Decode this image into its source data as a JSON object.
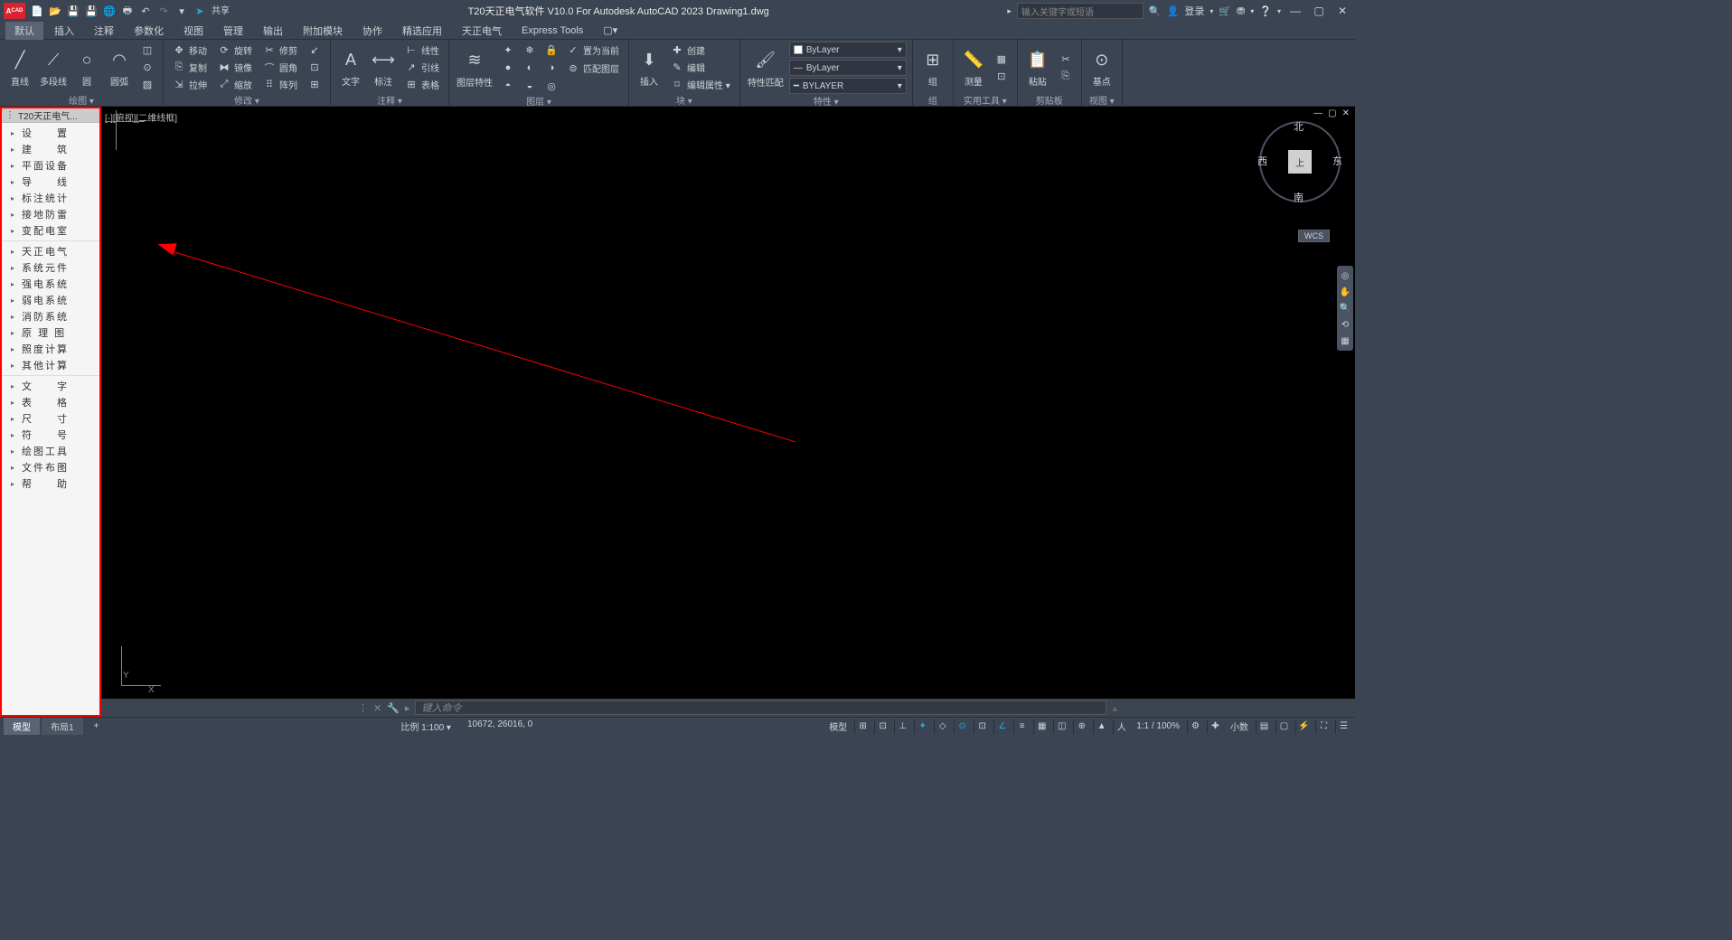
{
  "title": "T20天正电气软件 V10.0 For Autodesk AutoCAD 2023    Drawing1.dwg",
  "qat_share": "共享",
  "search_placeholder": "输入关键字或短语",
  "login": "登录",
  "menubar": [
    "默认",
    "插入",
    "注释",
    "参数化",
    "视图",
    "管理",
    "输出",
    "附加模块",
    "协作",
    "精选应用",
    "天正电气",
    "Express Tools"
  ],
  "ribbon": {
    "draw": {
      "title": "绘图 ▾",
      "line": "直线",
      "polyline": "多段线",
      "circle": "圆",
      "arc": "圆弧"
    },
    "modify": {
      "title": "修改 ▾",
      "move": "移动",
      "rotate": "旋转",
      "trim": "修剪",
      "copy": "复制",
      "mirror": "镜像",
      "fillet": "圆角",
      "stretch": "拉伸",
      "scale": "缩放",
      "array": "阵列"
    },
    "annot": {
      "title": "注释 ▾",
      "text": "文字",
      "dim": "标注",
      "leader": "引线",
      "table": "表格",
      "linear": "线性"
    },
    "layers": {
      "title": "图层 ▾",
      "props": "图层特性",
      "current": "置为当前",
      "match": "匹配图层",
      "combo": "ByLayer"
    },
    "block": {
      "title": "块 ▾",
      "insert": "插入",
      "create": "创建",
      "edit": "编辑",
      "attr": "编辑属性 ▾"
    },
    "props": {
      "title": "特性 ▾",
      "match": "特性匹配",
      "bylayer": "ByLayer",
      "bylayer2": "ByLayer",
      "bylayer3": "BYLAYER"
    },
    "group": {
      "title": "组",
      "g": "组"
    },
    "util": {
      "title": "实用工具 ▾",
      "measure": "测量"
    },
    "clip": {
      "title": "剪贴板",
      "paste": "粘贴"
    },
    "view": {
      "title": "视图 ▾",
      "base": "基点"
    }
  },
  "side_panel": {
    "header": "T20天正电气...",
    "group1": [
      "设　　置",
      "建　　筑",
      "平面设备",
      "导　　线",
      "标注统计",
      "接地防雷",
      "变配电室"
    ],
    "group2": [
      "天正电气",
      "系统元件",
      "强电系统",
      "弱电系统",
      "消防系统",
      "原 理 图",
      "照度计算",
      "其他计算"
    ],
    "group3": [
      "文　　字",
      "表　　格",
      "尺　　寸",
      "符　　号",
      "绘图工具",
      "文件布图",
      "帮　　助"
    ]
  },
  "viewport_label": "[-][俯视][二维线框]",
  "viewcube": {
    "n": "北",
    "s": "南",
    "e": "东",
    "w": "西",
    "top": "上",
    "wcs": "WCS"
  },
  "ucs": {
    "x": "X",
    "y": "Y"
  },
  "cmd": {
    "prompt": "键入命令"
  },
  "status": {
    "model": "模型",
    "layout": "布局1",
    "plus": "+",
    "scale": "比例 1:100 ▾",
    "coords": "10672, 26016, 0",
    "model2": "模型",
    "zoom": "1:1 / 100%",
    "dec": "小数"
  }
}
